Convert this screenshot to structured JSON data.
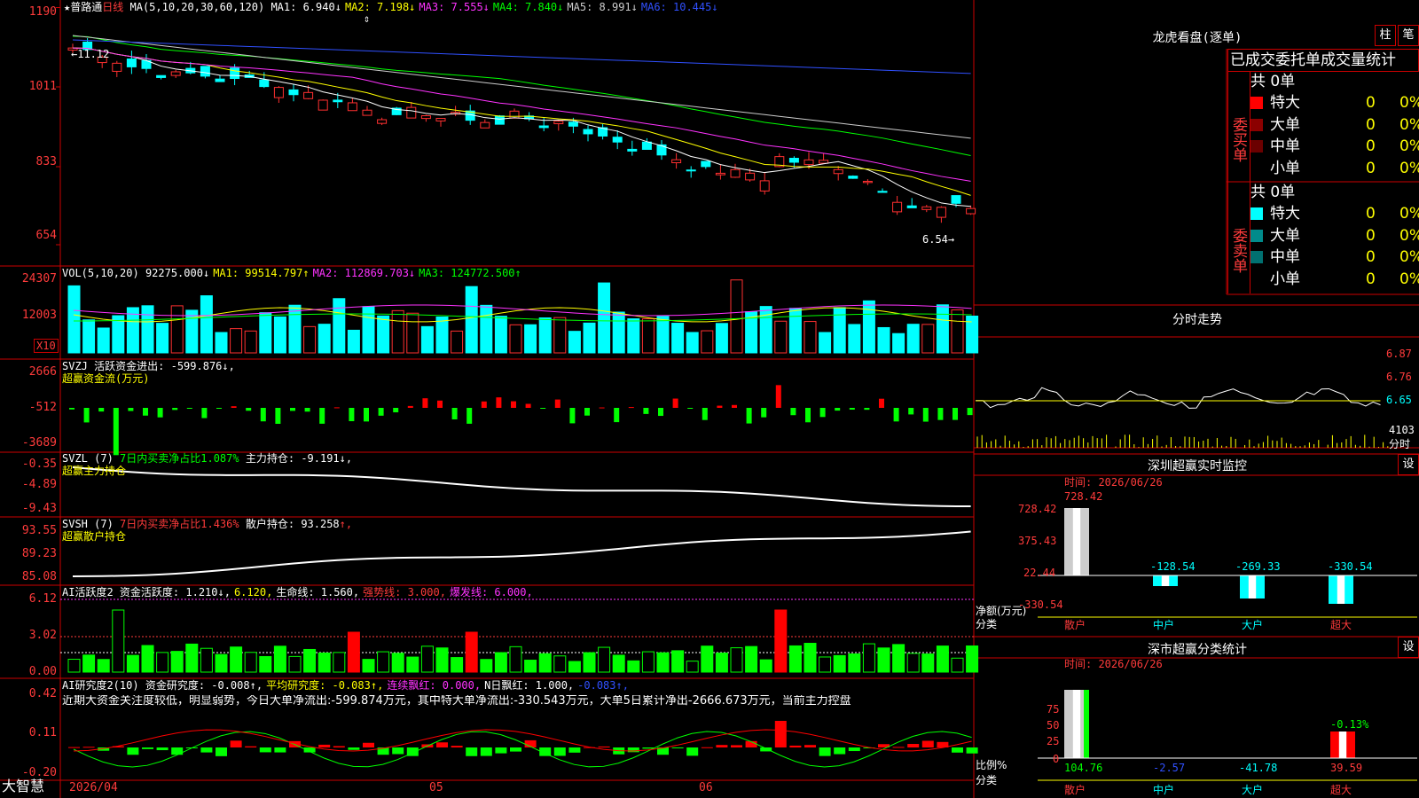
{
  "candle": {
    "y_top": "1190",
    "y_marks": [
      "1011",
      "833",
      "654"
    ],
    "stock_star": "★",
    "stock_name": "普路通",
    "period": "日线",
    "ma_head": "MA(5,10,20,30,60,120)",
    "ma_items": [
      {
        "t": "MA1: 6.940",
        "a": "↓",
        "c": "#ffffff"
      },
      {
        "t": "MA2: 7.198",
        "a": "↓",
        "c": "#ffff00"
      },
      {
        "t": "MA3: 7.555",
        "a": "↓",
        "c": "#ff33ff"
      },
      {
        "t": "MA4: 7.840",
        "a": "↓",
        "c": "#00ff00"
      },
      {
        "t": "MA5: 8.991",
        "a": "↓",
        "c": "#cccccc"
      },
      {
        "t": "MA6: 10.445",
        "a": "↓",
        "c": "#3050ff"
      }
    ],
    "hi_label": "←11.12",
    "lo_label": "6.54→"
  },
  "vol": {
    "y_marks": [
      "24307",
      "12003"
    ],
    "unit": "X10",
    "head": "VOL(5,10,20)",
    "items": [
      {
        "t": "92275.000",
        "a": "↓",
        "c": "#ffffff"
      },
      {
        "t": "MA1: 99514.797",
        "a": "↑",
        "c": "#ffff00"
      },
      {
        "t": "MA2: 112869.703",
        "a": "↓",
        "c": "#ff33ff"
      },
      {
        "t": "MA3: 124772.500",
        "a": "↑",
        "c": "#00ff00"
      }
    ]
  },
  "svzj": {
    "y_marks": [
      "2666",
      "-512",
      "-3689"
    ],
    "head": "SVZJ",
    "name": "活跃资金进出:",
    "val": "-599.876",
    "arrow": "↓,",
    "sub": "超赢资金流(万元)"
  },
  "svzl": {
    "y_marks": [
      "-0.35",
      "-4.89",
      "-9.43"
    ],
    "head": "SVZL (7)",
    "item1": "7日内买卖净占比1.087%",
    "item2": "主力持仓:",
    "val": "-9.191",
    "arrow": "↓,",
    "sub": "超赢主力持仓"
  },
  "svsh": {
    "y_marks": [
      "93.55",
      "89.23",
      "85.08"
    ],
    "head": "SVSH (7)",
    "item1": "7日内买卖净占比1.436%",
    "item2": "散户持仓:",
    "val": "93.258",
    "arrow": "↑,",
    "sub": "超赢散户持仓"
  },
  "ai1": {
    "y_marks": [
      "6.12",
      "3.02",
      "0.00"
    ],
    "head": "AI活跃度2",
    "items": [
      {
        "t": "资金活跃度: 1.210",
        "a": "↓,",
        "c": "#ffffff"
      },
      {
        "t": "6.120,",
        "a": "",
        "c": "#ffff00"
      },
      {
        "t": "生命线: 1.560,",
        "a": "",
        "c": "#ffffff"
      },
      {
        "t": "强势线: 3.000,",
        "a": "",
        "c": "#ff3b3b"
      },
      {
        "t": "爆发线: 6.000,",
        "a": "",
        "c": "#ff33ff"
      }
    ]
  },
  "ai2": {
    "y_marks": [
      "0.42",
      "0.11",
      "-0.20"
    ],
    "head": "AI研究度2(10)",
    "items": [
      {
        "t": "资金研究度: -0.008",
        "a": "↑,",
        "c": "#ffffff"
      },
      {
        "t": "平均研究度: -0.083",
        "a": "↑,",
        "c": "#ffff00"
      },
      {
        "t": "连续飘红: 0.000,",
        "a": "",
        "c": "#ff33ff"
      },
      {
        "t": "N日飘红: 1.000,",
        "a": "",
        "c": "#ffffff"
      },
      {
        "t": "-0.083",
        "a": "↑,",
        "c": "#3050ff"
      }
    ],
    "text": "近期大资金关注度较低，明显弱势，今日大单净流出:-599.874万元，其中特大单净流出:-330.543万元，大单5日累计净出-2666.673万元，当前主力控盘"
  },
  "xaxis": {
    "brand": "大智慧",
    "dates": [
      "2026/04",
      "05",
      "06"
    ]
  },
  "right": {
    "title": "龙虎看盘(逐单)",
    "btn1": "柱",
    "btn2": "笔",
    "tabs_text": "已成交委托单成交量统计",
    "buy_label": "委买单",
    "sell_label": "委卖单",
    "buy_total": "共 0单",
    "sell_total": "共 0单",
    "buy_rows": [
      {
        "n": "特大",
        "v": "0",
        "p": "0%",
        "c": "#ff0000"
      },
      {
        "n": "大单",
        "v": "0",
        "p": "0%",
        "c": "#8b0000"
      },
      {
        "n": "中单",
        "v": "0",
        "p": "0%",
        "c": "#6b0000"
      },
      {
        "n": "小单",
        "v": "0",
        "p": "0%",
        "c": "#000000"
      }
    ],
    "sell_rows": [
      {
        "n": "特大",
        "v": "0",
        "p": "0%",
        "c": "#00ffff"
      },
      {
        "n": "大单",
        "v": "0",
        "p": "0%",
        "c": "#008b8b"
      },
      {
        "n": "中单",
        "v": "0",
        "p": "0%",
        "c": "#007070"
      },
      {
        "n": "小单",
        "v": "0",
        "p": "0%",
        "c": "#000000"
      }
    ],
    "intraday": {
      "title": "分时走势",
      "y": [
        "6.87",
        "6.76",
        "6.65"
      ],
      "vol": "4103",
      "unit": "分时"
    },
    "monitor": {
      "title": "深圳超赢实时监控",
      "btn": "设",
      "time": "时间: 2026/06/26",
      "y": [
        "728.42",
        "375.43",
        "22.44",
        "-330.54"
      ],
      "label1": "净额(万元)",
      "label2": "分类",
      "cats": [
        "散户",
        "中户",
        "大户",
        "超大"
      ],
      "vals": [
        "728.42",
        "-128.54",
        "-269.33",
        "-330.54"
      ]
    },
    "stat": {
      "title": "深市超赢分类统计",
      "btn": "设",
      "time": "时间: 2026/06/26",
      "y": [
        "75",
        "50",
        "25",
        "0"
      ],
      "label1": "比例%",
      "label2": "分类",
      "cats": [
        "散户",
        "中户",
        "大户",
        "超大"
      ],
      "vals": [
        "104.76",
        "-2.57",
        "-41.78",
        "39.59"
      ],
      "note": "-0.13%"
    }
  }
}
